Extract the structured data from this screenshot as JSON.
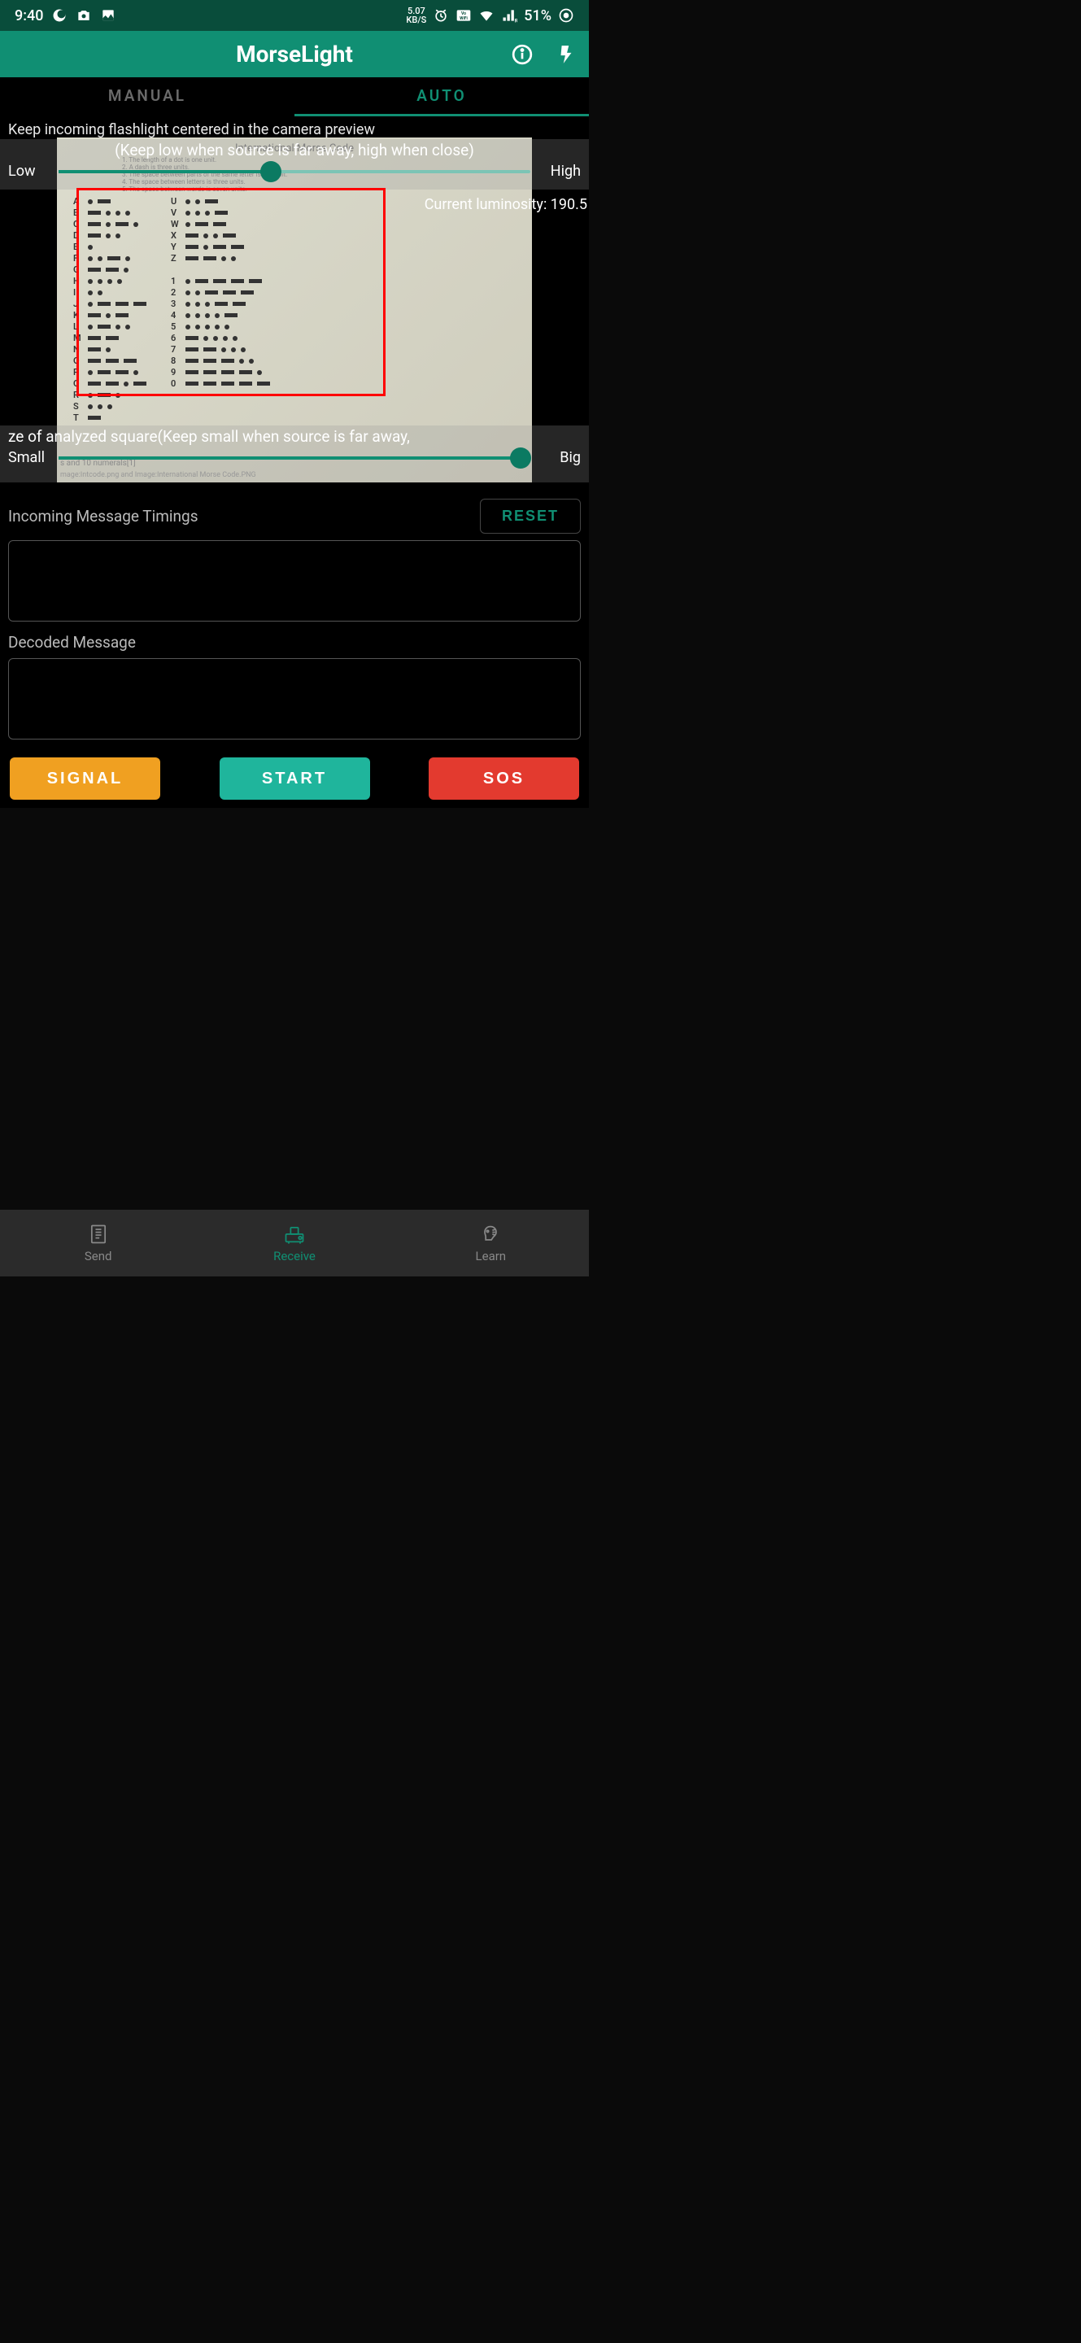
{
  "status": {
    "time": "9:40",
    "net_speed_top": "5.07",
    "net_speed_bot": "KB/S",
    "battery": "51%"
  },
  "app": {
    "title": "MorseLight"
  },
  "tabs": {
    "manual": "MANUAL",
    "auto": "AUTO"
  },
  "preview": {
    "instruction": "Keep incoming flashlight centered in the camera preview",
    "sensitivity_hint": "(Keep low when source is far away, high when close)",
    "sensitivity_low": "Low",
    "sensitivity_high": "High",
    "sensitivity_value_pct": 45,
    "luminosity_label": "Current luminosity: 190.5",
    "square_hint": "ze of analyzed square(Keep small when source is far away,",
    "square_small": "Small",
    "square_big": "Big",
    "square_value_pct": 98,
    "chart_title": "International Morse Code",
    "chart_rules": [
      "1. The length of a dot is one unit.",
      "2. A dash is three units.",
      "3. The space between parts of the same letter is one unit.",
      "4. The space between letters is three units.",
      "5. The space between words is seven units."
    ],
    "chart_caption_left": "s and 10 numerals[1]",
    "chart_caption_bottom": "mage:Intcode.png and Image:International Morse Code.PNG"
  },
  "sections": {
    "timings_title": "Incoming Message Timings",
    "reset": "RESET",
    "timings_value": "",
    "decoded_title": "Decoded Message",
    "decoded_value": ""
  },
  "actions": {
    "signal": "SIGNAL",
    "start": "START",
    "sos": "SOS"
  },
  "nav": {
    "send": "Send",
    "receive": "Receive",
    "learn": "Learn"
  },
  "morse": {
    "col1": [
      {
        "l": "A",
        "p": [
          ".",
          "-"
        ]
      },
      {
        "l": "B",
        "p": [
          "-",
          ".",
          ".",
          "."
        ]
      },
      {
        "l": "C",
        "p": [
          "-",
          ".",
          "-",
          "."
        ]
      },
      {
        "l": "D",
        "p": [
          "-",
          ".",
          "."
        ]
      },
      {
        "l": "E",
        "p": [
          "."
        ]
      },
      {
        "l": "F",
        "p": [
          ".",
          ".",
          "-",
          "."
        ]
      },
      {
        "l": "G",
        "p": [
          "-",
          "-",
          "."
        ]
      },
      {
        "l": "H",
        "p": [
          ".",
          ".",
          ".",
          "."
        ]
      },
      {
        "l": "I",
        "p": [
          ".",
          "."
        ]
      },
      {
        "l": "J",
        "p": [
          ".",
          "-",
          "-",
          "-"
        ]
      },
      {
        "l": "K",
        "p": [
          "-",
          ".",
          "-"
        ]
      },
      {
        "l": "L",
        "p": [
          ".",
          "-",
          ".",
          "."
        ]
      },
      {
        "l": "M",
        "p": [
          "-",
          "-"
        ]
      },
      {
        "l": "N",
        "p": [
          "-",
          "."
        ]
      },
      {
        "l": "O",
        "p": [
          "-",
          "-",
          "-"
        ]
      },
      {
        "l": "P",
        "p": [
          ".",
          "-",
          "-",
          "."
        ]
      },
      {
        "l": "Q",
        "p": [
          "-",
          "-",
          ".",
          "-"
        ]
      },
      {
        "l": "R",
        "p": [
          ".",
          "-",
          "."
        ]
      },
      {
        "l": "S",
        "p": [
          ".",
          ".",
          "."
        ]
      },
      {
        "l": "T",
        "p": [
          "-"
        ]
      }
    ],
    "col2": [
      {
        "l": "U",
        "p": [
          ".",
          ".",
          "-"
        ]
      },
      {
        "l": "V",
        "p": [
          ".",
          ".",
          ".",
          "-"
        ]
      },
      {
        "l": "W",
        "p": [
          ".",
          "-",
          "-"
        ]
      },
      {
        "l": "X",
        "p": [
          "-",
          ".",
          ".",
          "-"
        ]
      },
      {
        "l": "Y",
        "p": [
          "-",
          ".",
          "-",
          "-"
        ]
      },
      {
        "l": "Z",
        "p": [
          "-",
          "-",
          ".",
          "."
        ]
      },
      {
        "l": "",
        "p": []
      },
      {
        "l": "1",
        "p": [
          ".",
          "-",
          "-",
          "-",
          "-"
        ]
      },
      {
        "l": "2",
        "p": [
          ".",
          ".",
          "-",
          "-",
          "-"
        ]
      },
      {
        "l": "3",
        "p": [
          ".",
          ".",
          ".",
          "-",
          "-"
        ]
      },
      {
        "l": "4",
        "p": [
          ".",
          ".",
          ".",
          ".",
          "-"
        ]
      },
      {
        "l": "5",
        "p": [
          ".",
          ".",
          ".",
          ".",
          "."
        ]
      },
      {
        "l": "6",
        "p": [
          "-",
          ".",
          ".",
          ".",
          "."
        ]
      },
      {
        "l": "7",
        "p": [
          "-",
          "-",
          ".",
          ".",
          "."
        ]
      },
      {
        "l": "8",
        "p": [
          "-",
          "-",
          "-",
          ".",
          "."
        ]
      },
      {
        "l": "9",
        "p": [
          "-",
          "-",
          "-",
          "-",
          "."
        ]
      },
      {
        "l": "0",
        "p": [
          "-",
          "-",
          "-",
          "-",
          "-"
        ]
      }
    ]
  }
}
